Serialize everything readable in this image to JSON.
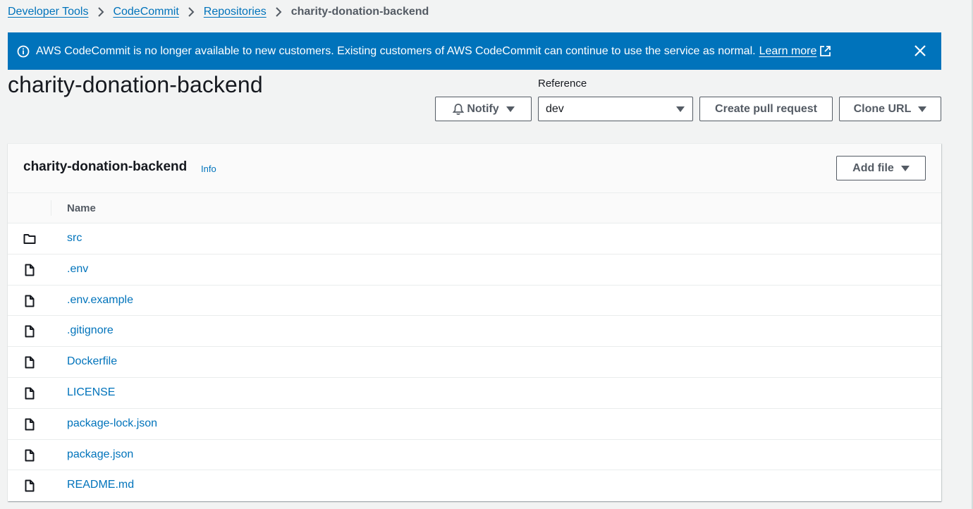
{
  "breadcrumb": {
    "items": [
      "Developer Tools",
      "CodeCommit",
      "Repositories"
    ],
    "current": "charity-donation-backend"
  },
  "banner": {
    "message": "AWS CodeCommit is no longer available to new customers. Existing customers of AWS CodeCommit can continue to use the service as normal.",
    "link": "Learn more",
    "color": "#0073bb"
  },
  "page": {
    "title": "charity-donation-backend"
  },
  "toolbar": {
    "notify_label": "Notify",
    "reference_label": "Reference",
    "reference_value": "dev",
    "create_pr_label": "Create pull request",
    "clone_url_label": "Clone URL"
  },
  "panel": {
    "title": "charity-donation-backend",
    "info_label": "Info",
    "add_file_label": "Add file",
    "column_name": "Name"
  },
  "files": [
    {
      "name": "src",
      "type": "folder-icon"
    },
    {
      "name": ".env",
      "type": "file-icon"
    },
    {
      "name": ".env.example",
      "type": "file-icon"
    },
    {
      "name": ".gitignore",
      "type": "file-icon"
    },
    {
      "name": "Dockerfile",
      "type": "file-icon"
    },
    {
      "name": "LICENSE",
      "type": "file-icon"
    },
    {
      "name": "package-lock.json",
      "type": "file-icon"
    },
    {
      "name": "package.json",
      "type": "file-icon"
    },
    {
      "name": "README.md",
      "type": "file-icon"
    }
  ],
  "colors": {
    "link": "#0073bb",
    "text": "#16191f",
    "muted": "#545b64"
  }
}
